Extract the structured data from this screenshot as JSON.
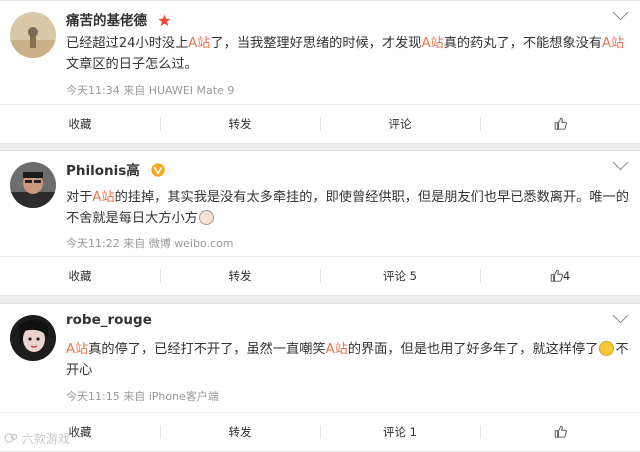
{
  "posts": [
    {
      "username": "痛苦的基佬德",
      "content_parts": [
        "已经超过24小时没上",
        "A站",
        "了，当我整理好思绪的时候，才发现",
        "A站",
        "真的药丸了，不能想象没有",
        "A站",
        "文章区的日子怎么过。"
      ],
      "meta": "今天11:34 来自 HUAWEI Mate 9",
      "actions": {
        "favorite": "收藏",
        "repost": "转发",
        "comment": "评论",
        "like": ""
      }
    },
    {
      "username": "Philonis高",
      "content_parts": [
        "对于",
        "A站",
        "的挂掉，其实我是没有太多牵挂的，即使曾经供职，但是朋友们也早已悉数离开。唯一的不舍就是每日大方小方"
      ],
      "meta": "今天11:22 来自 微博 weibo.com",
      "actions": {
        "favorite": "收藏",
        "repost": "转发",
        "comment": "评论 5",
        "like": "4"
      }
    },
    {
      "username": "robe_rouge",
      "content_parts": [
        "A站",
        "真的停了，已经打不开了，虽然一直嘲笑",
        "A站",
        "的界面，但是也用了好多年了，就这样停了",
        "不开心"
      ],
      "meta": "今天11:15 来自 iPhone客户端",
      "actions": {
        "favorite": "收藏",
        "repost": "转发",
        "comment": "评论 1",
        "like": ""
      }
    }
  ],
  "watermark": "六款游戏",
  "colors": {
    "highlight": "#eb7350",
    "meta": "#999999",
    "background": "#eeeeee"
  },
  "icons": {
    "expand": "chevron-down-icon",
    "like": "thumbs-up-icon",
    "badge1": "red-star-icon",
    "badge2": "yellow-v-icon"
  }
}
